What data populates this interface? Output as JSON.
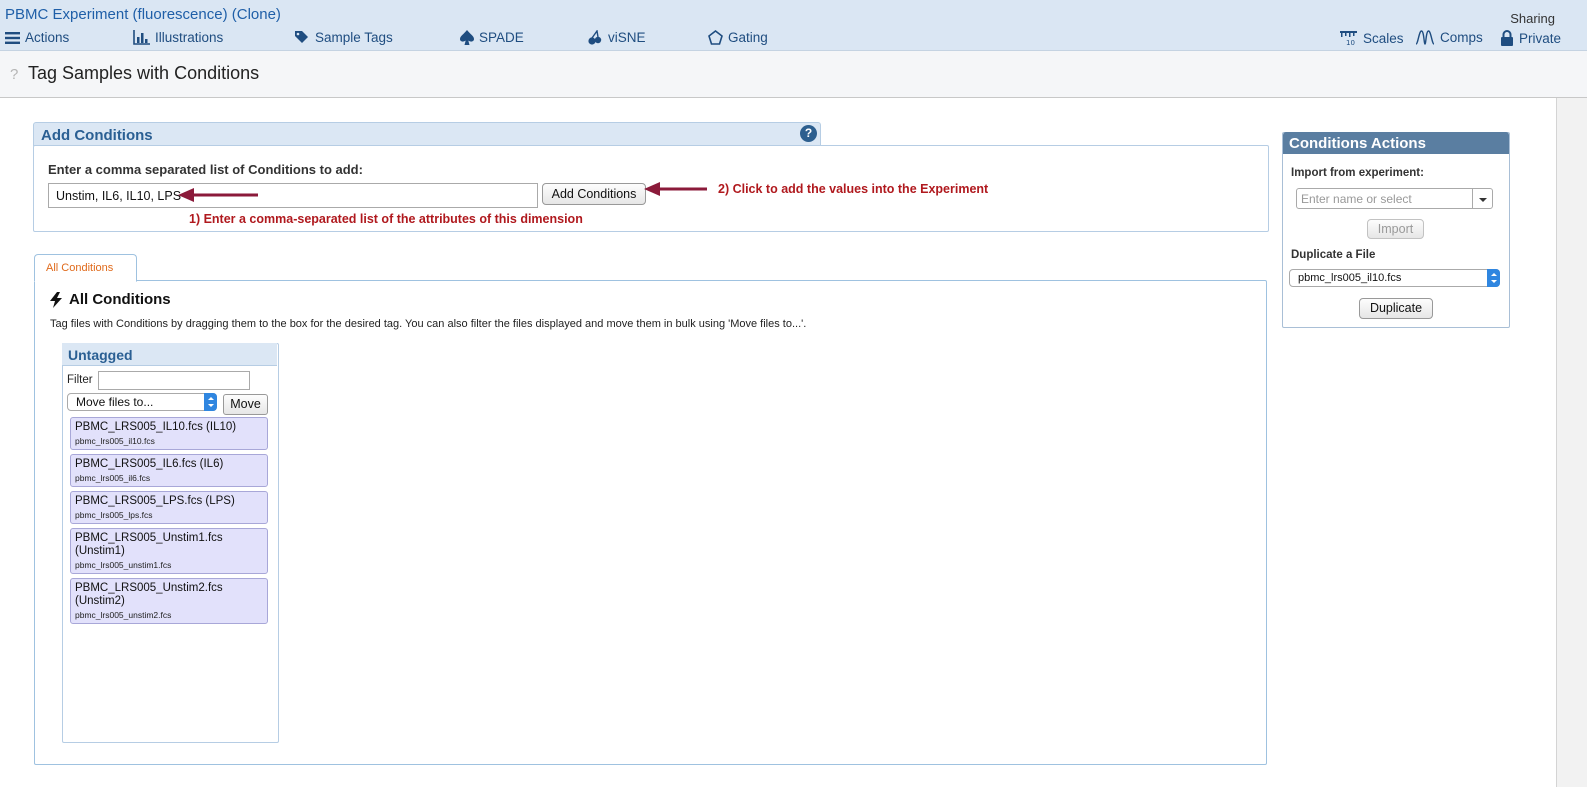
{
  "app": {
    "title": "PBMC Experiment (fluorescence) (Clone)",
    "sharing_label": "Sharing"
  },
  "nav": {
    "actions": "Actions",
    "illustrations": "Illustrations",
    "sample_tags": "Sample Tags",
    "spade": "SPADE",
    "visne": "viSNE",
    "gating": "Gating",
    "scales": "Scales",
    "comps": "Comps",
    "private": "Private"
  },
  "page": {
    "help_mark": "?",
    "title": "Tag Samples with Conditions"
  },
  "add_conditions": {
    "header": "Add Conditions",
    "help_badge": "?",
    "prompt": "Enter a comma separated list of Conditions to add:",
    "input_value": "Unstim, IL6, IL10, LPS",
    "button": "Add Conditions",
    "annotation_1": "1) Enter a comma-separated list of the attributes of this dimension",
    "annotation_2": "2) Click to add the values into the Experiment"
  },
  "tabs": {
    "all_conditions": "All Conditions"
  },
  "all_conditions": {
    "title": "All Conditions",
    "description": "Tag files with Conditions by dragging them to the box for the desired tag. You can also filter the files displayed and move them in bulk using 'Move files to...'."
  },
  "untagged": {
    "header": "Untagged",
    "filter_label": "Filter",
    "filter_value": "",
    "move_select": "Move files to...",
    "move_button": "Move",
    "files": [
      {
        "name": "PBMC_LRS005_IL10.fcs (IL10)",
        "file": "pbmc_lrs005_il10.fcs"
      },
      {
        "name": "PBMC_LRS005_IL6.fcs (IL6)",
        "file": "pbmc_lrs005_il6.fcs"
      },
      {
        "name": "PBMC_LRS005_LPS.fcs (LPS)",
        "file": "pbmc_lrs005_lps.fcs"
      },
      {
        "name": "PBMC_LRS005_Unstim1.fcs (Unstim1)",
        "file": "pbmc_lrs005_unstim1.fcs"
      },
      {
        "name": "PBMC_LRS005_Unstim2.fcs (Unstim2)",
        "file": "pbmc_lrs005_unstim2.fcs"
      }
    ]
  },
  "conditions_actions": {
    "header": "Conditions Actions",
    "import_label": "Import from experiment:",
    "import_placeholder": "Enter name or select",
    "import_button": "Import",
    "duplicate_label": "Duplicate a File",
    "duplicate_select": "pbmc_lrs005_il10.fcs",
    "duplicate_button": "Duplicate"
  },
  "colors": {
    "topbar": "#dae6f3",
    "link": "#1f4d80",
    "panel_header": "#dbe7f4",
    "annotation": "#b0191e",
    "arrow": "#8b1a3a",
    "card": "#e2e1fb",
    "sidebar_header": "#5a7ea1"
  }
}
